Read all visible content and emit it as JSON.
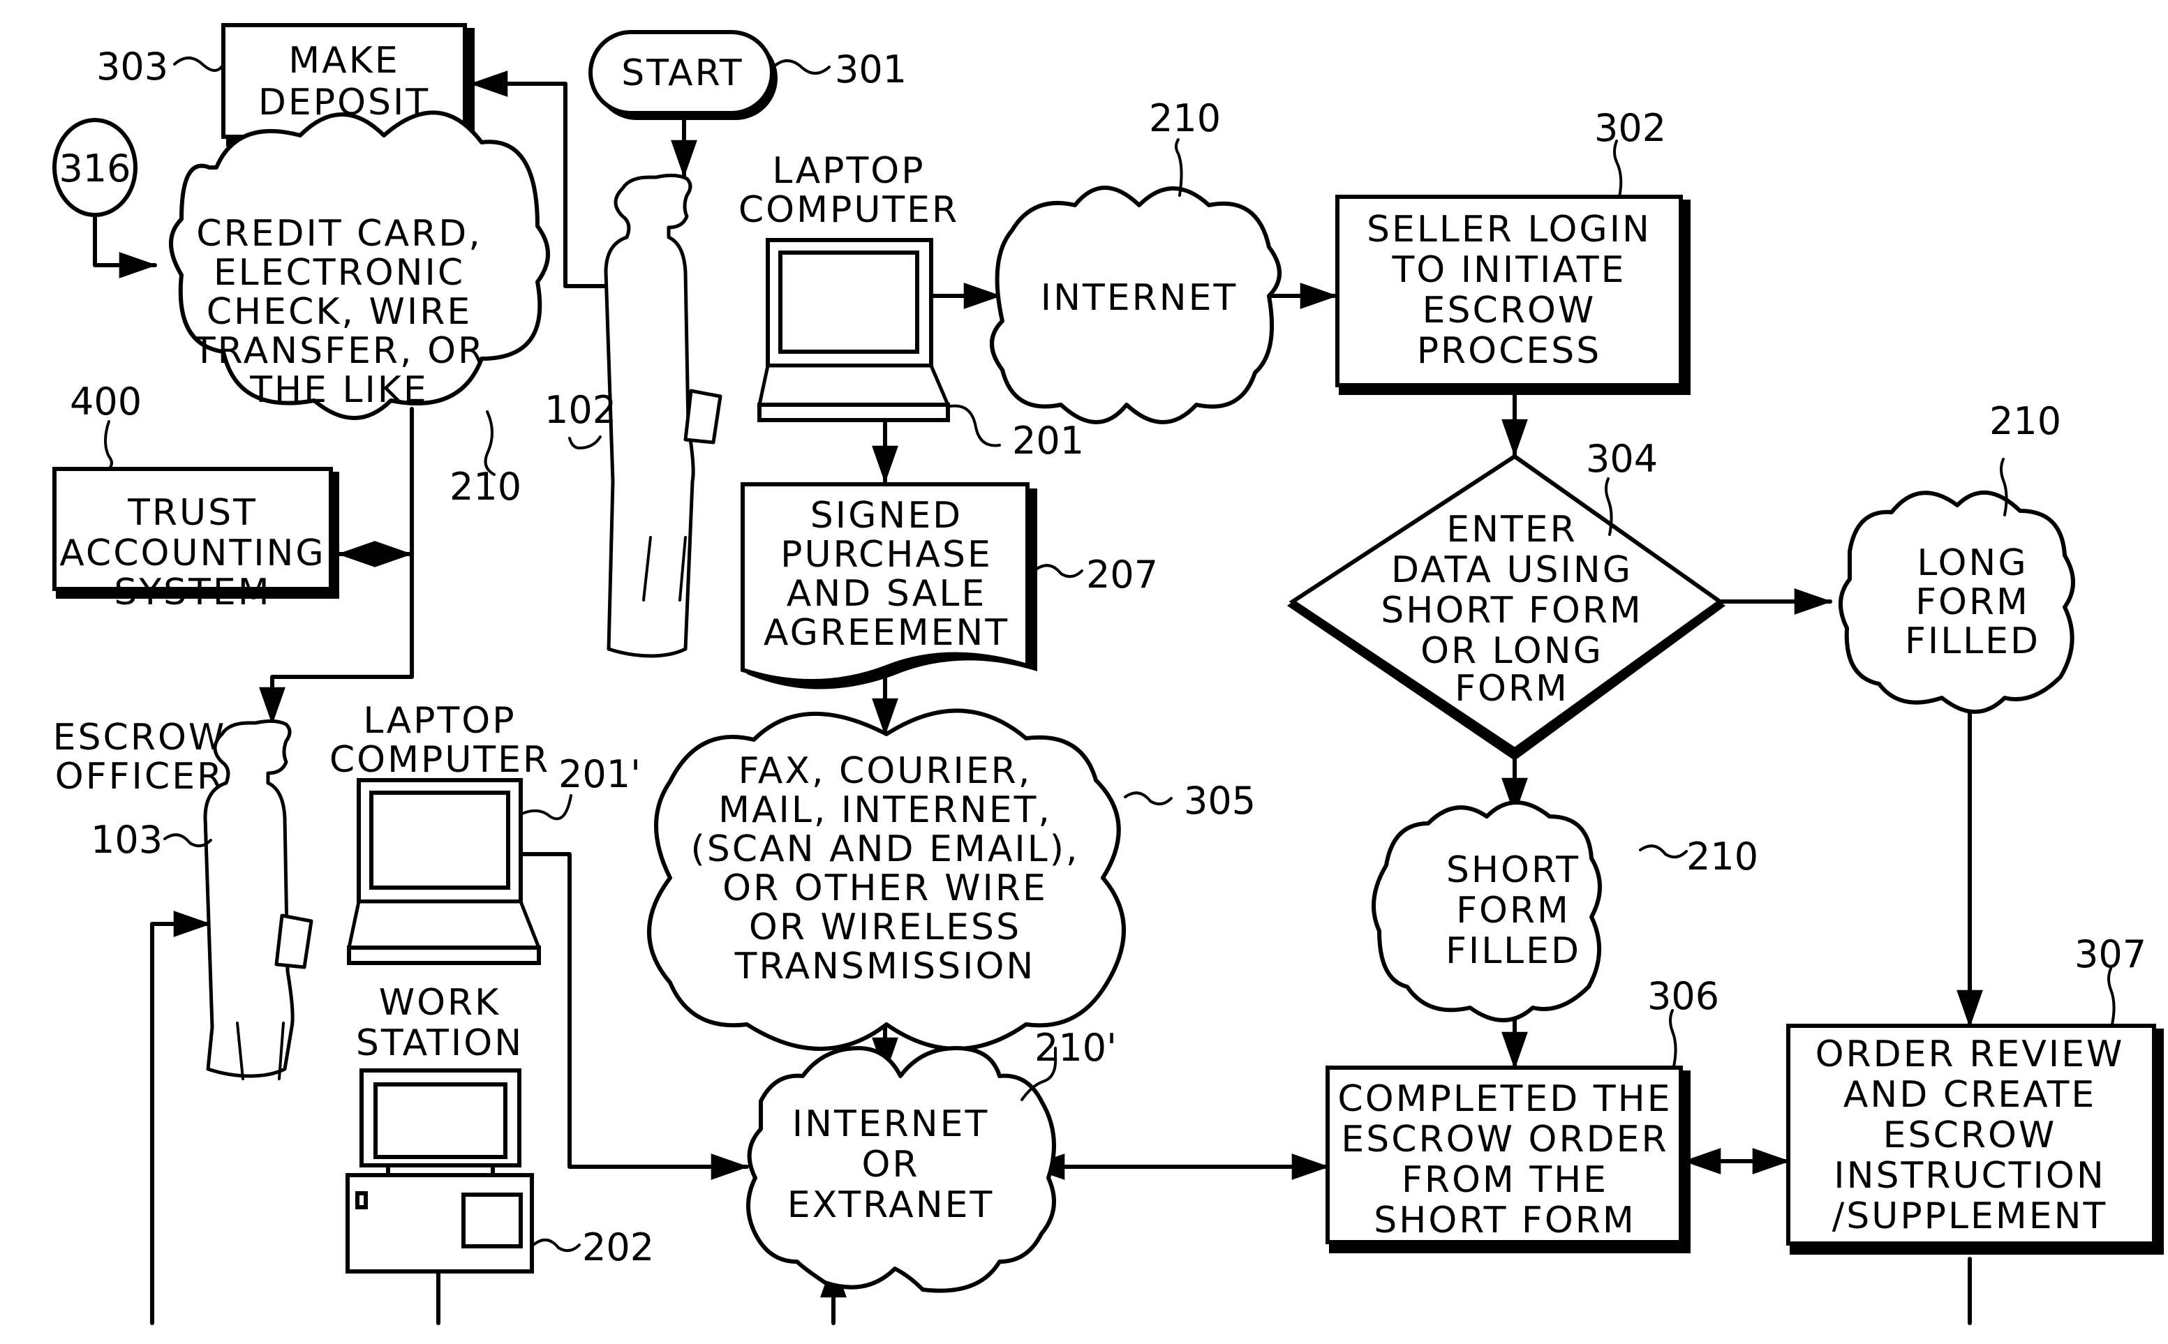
{
  "diagram": {
    "type": "patent-flowchart",
    "subject": "Online escrow process"
  },
  "nodes": {
    "start": {
      "ref": "301",
      "lines": [
        "START"
      ]
    },
    "make_deposit": {
      "ref": "303",
      "lines": [
        "MAKE",
        "DEPOSIT"
      ]
    },
    "connector_316": {
      "ref": "316"
    },
    "payment_methods": {
      "ref": "210",
      "lines": [
        "CREDIT CARD,",
        "ELECTRONIC",
        "CHECK, WIRE",
        "TRANSFER, OR",
        "THE LIKE"
      ]
    },
    "trust_accounting": {
      "ref": "400",
      "lines": [
        "TRUST",
        "ACCOUNTING",
        "SYSTEM"
      ]
    },
    "seller": {
      "ref": "102"
    },
    "seller_laptop": {
      "ref": "201",
      "lines": [
        "LAPTOP",
        "COMPUTER"
      ]
    },
    "internet": {
      "ref": "210",
      "lines": [
        "INTERNET"
      ]
    },
    "seller_login": {
      "ref": "302",
      "lines": [
        "SELLER LOGIN",
        "TO INITIATE",
        "ESCROW",
        "PROCESS"
      ]
    },
    "enter_data": {
      "ref": "304",
      "lines": [
        "ENTER",
        "DATA USING",
        "SHORT FORM",
        "OR LONG",
        "FORM"
      ]
    },
    "long_form": {
      "ref": "210",
      "lines": [
        "LONG",
        "FORM",
        "FILLED"
      ]
    },
    "agreement": {
      "ref": "207",
      "lines": [
        "SIGNED",
        "PURCHASE",
        "AND SALE",
        "AGREEMENT"
      ]
    },
    "transmission": {
      "ref": "305",
      "lines": [
        "FAX, COURIER,",
        "MAIL, INTERNET,",
        "(SCAN AND EMAIL),",
        "OR OTHER WIRE",
        "OR WIRELESS",
        "TRANSMISSION"
      ]
    },
    "escrow_officer": {
      "ref": "103",
      "lines": [
        "ESCROW",
        "OFFICER"
      ]
    },
    "officer_laptop": {
      "ref": "201'",
      "lines": [
        "LAPTOP",
        "COMPUTER"
      ]
    },
    "workstation": {
      "ref": "202",
      "lines": [
        "WORK",
        "STATION"
      ]
    },
    "extranet": {
      "ref": "210'",
      "lines": [
        "INTERNET",
        "OR",
        "EXTRANET"
      ]
    },
    "short_form": {
      "ref": "210",
      "lines": [
        "SHORT",
        "FORM",
        "FILLED"
      ]
    },
    "completed_order": {
      "ref": "306",
      "lines": [
        "COMPLETED THE",
        "ESCROW ORDER",
        "FROM THE",
        "SHORT FORM"
      ]
    },
    "order_review": {
      "ref": "307",
      "lines": [
        "ORDER REVIEW",
        "AND CREATE",
        "ESCROW",
        "INSTRUCTION",
        "/SUPPLEMENT"
      ]
    }
  },
  "edges": [
    {
      "from": "start",
      "to": "seller"
    },
    {
      "from": "seller",
      "to": "make_deposit"
    },
    {
      "from": "make_deposit",
      "to": "payment_methods"
    },
    {
      "from": "connector_316",
      "to": "payment_methods"
    },
    {
      "from": "payment_methods",
      "to": "trust_accounting",
      "bidirectional": true
    },
    {
      "from": "payment_methods",
      "to": "escrow_officer"
    },
    {
      "from": "seller_laptop",
      "to": "internet"
    },
    {
      "from": "internet",
      "to": "seller_login"
    },
    {
      "from": "seller_laptop",
      "to": "agreement"
    },
    {
      "from": "seller_login",
      "to": "enter_data"
    },
    {
      "from": "enter_data",
      "to": "long_form"
    },
    {
      "from": "enter_data",
      "to": "short_form"
    },
    {
      "from": "agreement",
      "to": "transmission"
    },
    {
      "from": "transmission",
      "to": "extranet"
    },
    {
      "from": "officer_laptop",
      "to": "extranet"
    },
    {
      "from": "extranet",
      "to": "completed_order",
      "bidirectional": true
    },
    {
      "from": "short_form",
      "to": "completed_order"
    },
    {
      "from": "completed_order",
      "to": "order_review",
      "bidirectional": true
    },
    {
      "from": "long_form",
      "to": "order_review"
    }
  ]
}
